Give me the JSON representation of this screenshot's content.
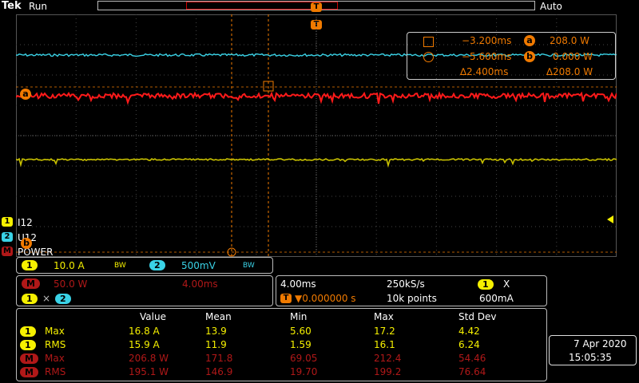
{
  "header": {
    "brand": "Tek",
    "run_state": "Run",
    "trigger_mode": "Auto",
    "trigger_marker": "T"
  },
  "cursor_readout": {
    "a_time": "−3.200ms",
    "a_value": "208.0 W",
    "b_time": "−5.600ms",
    "b_value": "0.000 W",
    "delta_time": "∆2.400ms",
    "delta_value": "∆208.0 W",
    "a_label": "a",
    "b_label": "b"
  },
  "channel_labels": {
    "ch1_marker": "1",
    "ch1_name": "I12",
    "ch2_marker": "2",
    "ch2_name": "U12",
    "math_marker": "M",
    "math_name": "POWER",
    "cursor_b_marker": "b"
  },
  "channel_settings": {
    "ch1_num": "1",
    "ch1_scale": "10.0 A",
    "ch1_bw": "BW",
    "ch2_num": "2",
    "ch2_scale": "500mV",
    "ch2_bw": "BW",
    "math_num": "M",
    "math_scale": "50.0 W",
    "math_time": "4.00ms",
    "math_src1": "1",
    "math_op": "×",
    "math_src2": "2"
  },
  "timebase": {
    "horizontal_scale": "4.00ms",
    "sample_rate": "250kS/s",
    "trigger_src": "1",
    "trigger_slope": "Χ",
    "trigger_pos": "▼0.000000 s",
    "record_length": "10k points",
    "trigger_level": "600mA"
  },
  "measurements": {
    "headers": [
      "Value",
      "Mean",
      "Min",
      "Max",
      "Std Dev"
    ],
    "rows": [
      {
        "src": "1",
        "name": "Max",
        "value": "16.8 A",
        "mean": "13.9",
        "min": "5.60",
        "max": "17.2",
        "std": "4.42"
      },
      {
        "src": "1",
        "name": "RMS",
        "value": "15.9 A",
        "mean": "11.9",
        "min": "1.59",
        "max": "16.1",
        "std": "6.24"
      },
      {
        "src": "M",
        "name": "Max",
        "value": "206.8 W",
        "mean": "171.8",
        "min": "69.05",
        "max": "212.4",
        "std": "54.46"
      },
      {
        "src": "M",
        "name": "RMS",
        "value": "195.1 W",
        "mean": "146.9",
        "min": "19.70",
        "max": "199.2",
        "std": "76.64"
      }
    ]
  },
  "datetime": {
    "date": "7 Apr 2020",
    "time": "15:05:35"
  },
  "colors": {
    "ch1": "#f5f000",
    "ch2": "#3ad2e6",
    "math": "#b01818",
    "trace_red": "#ff1a1a",
    "cursor": "#f07a00"
  }
}
